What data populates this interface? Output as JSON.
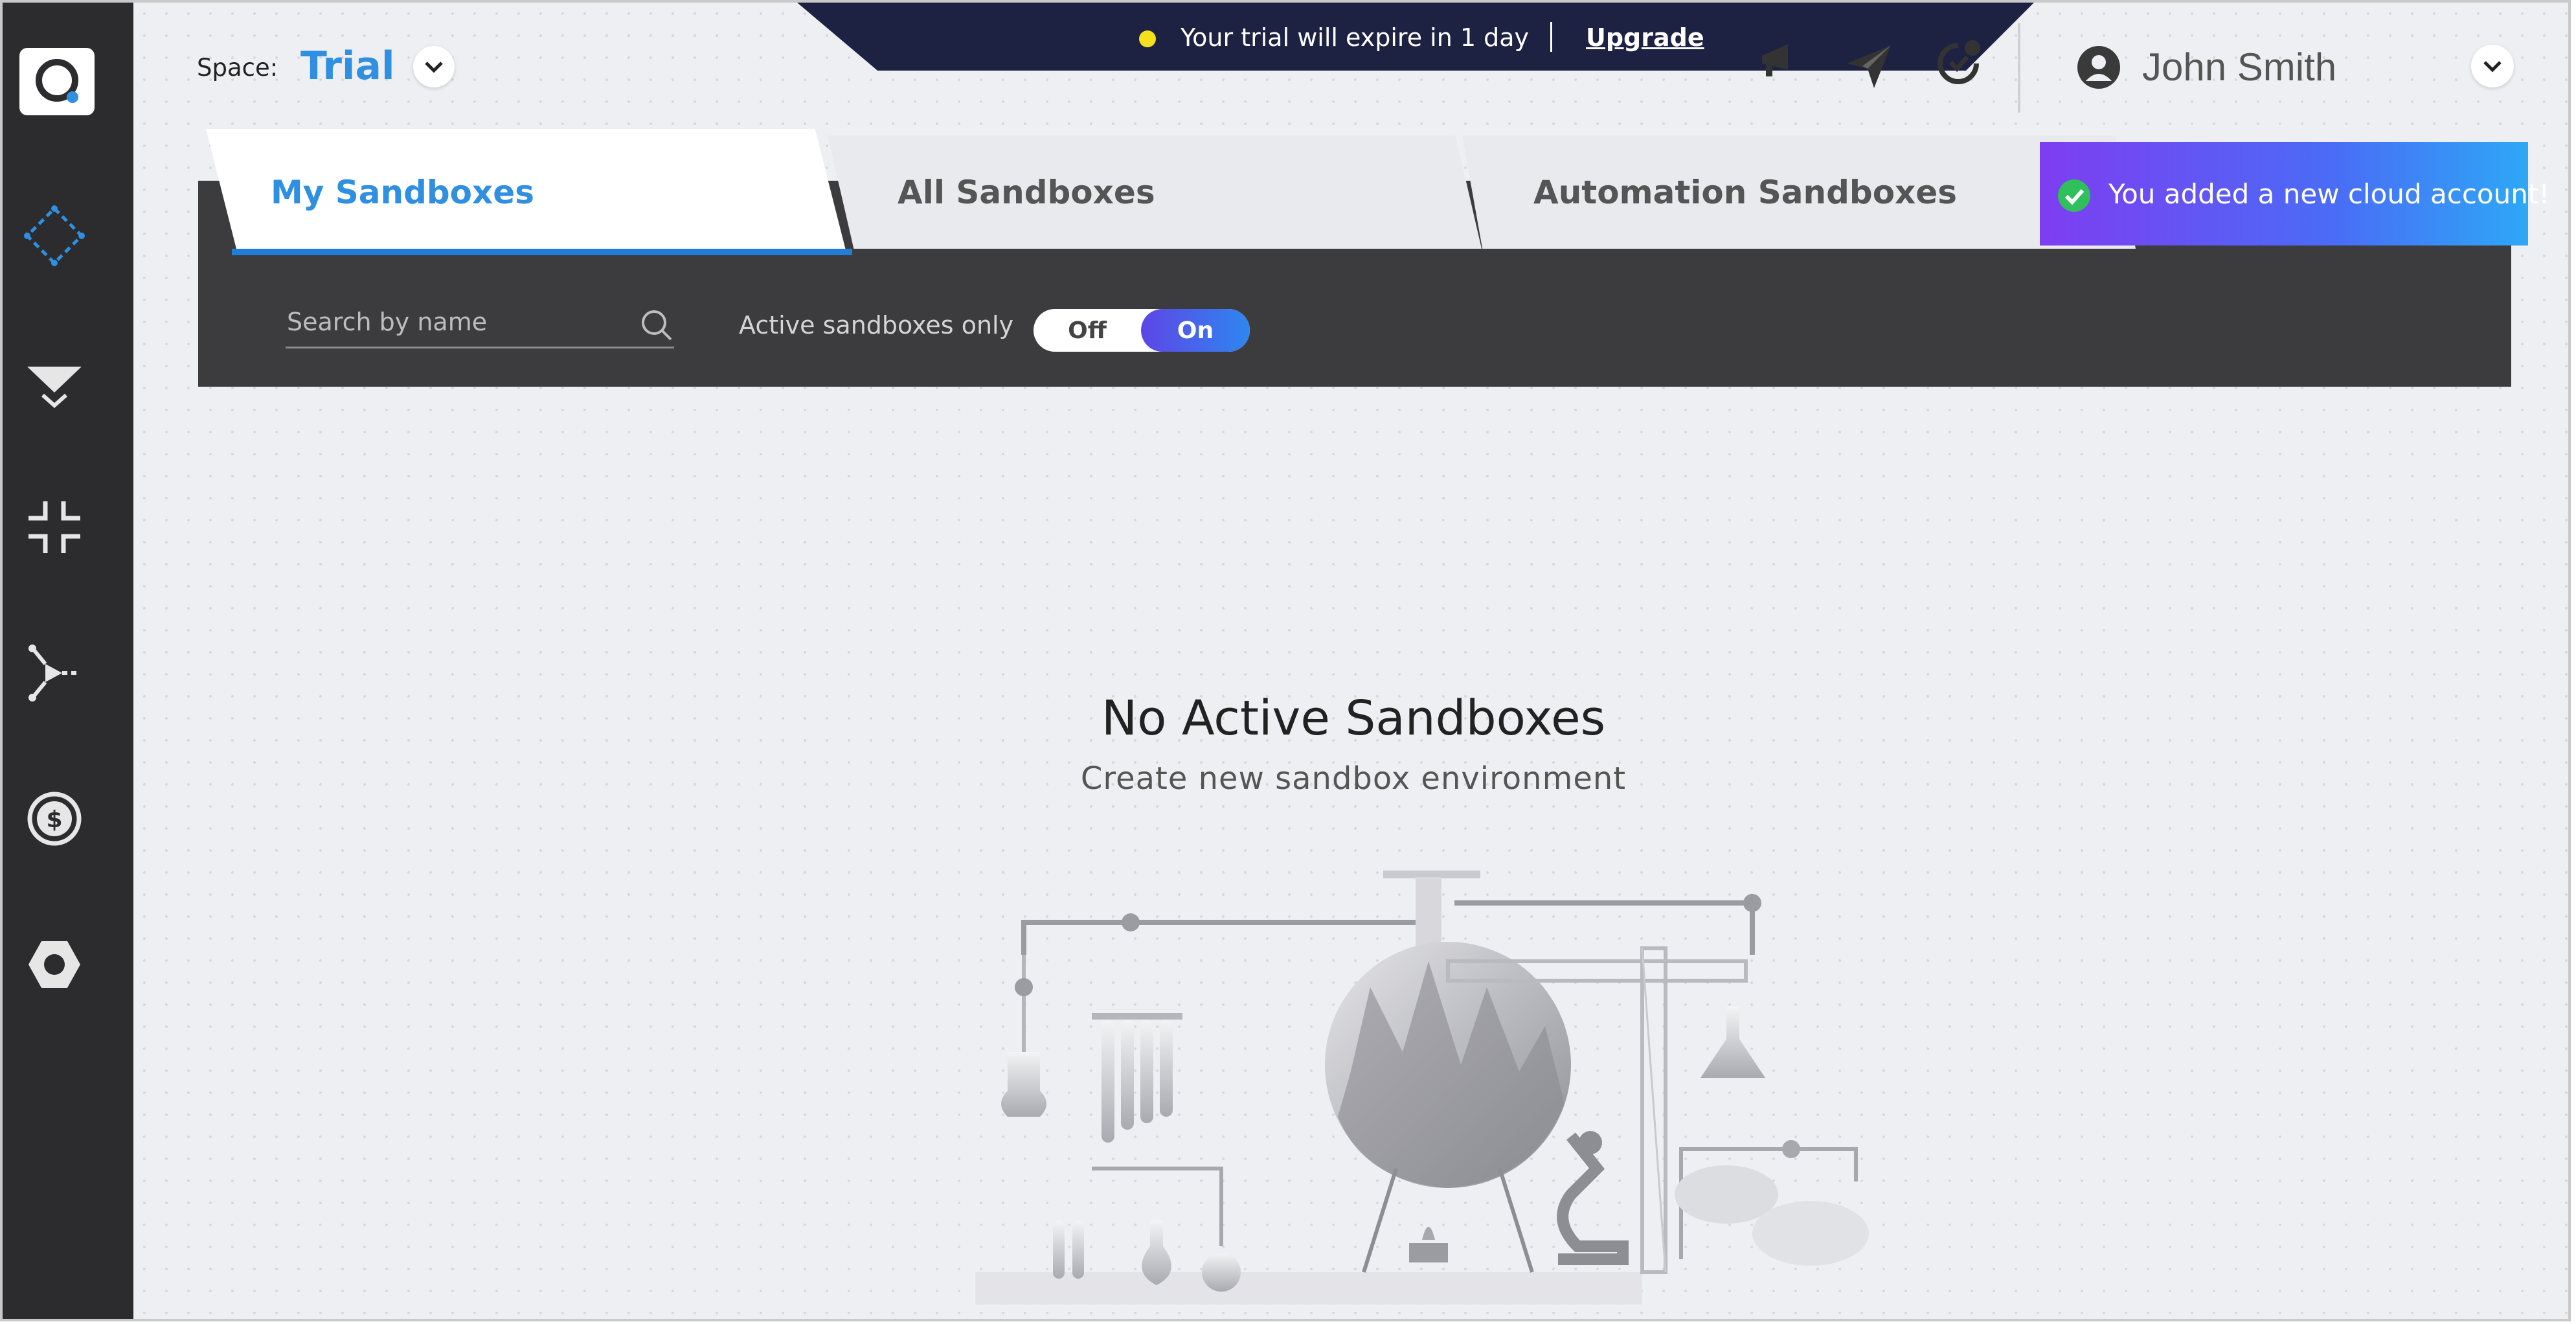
{
  "trial_banner": {
    "message": "Your trial will expire in 1 day",
    "upgrade_label": "Upgrade"
  },
  "space": {
    "label": "Space:",
    "value": "Trial"
  },
  "user": {
    "name": "John Smith"
  },
  "tabs": [
    {
      "label": "My Sandboxes",
      "active": true
    },
    {
      "label": "All Sandboxes",
      "active": false
    },
    {
      "label": "Automation Sandboxes",
      "active": false
    }
  ],
  "filters": {
    "search_placeholder": "Search by name",
    "active_only_label": "Active sandboxes only",
    "toggle_off_label": "Off",
    "toggle_on_label": "On",
    "toggle_state": "On"
  },
  "toast": {
    "message": "You added a new cloud account!"
  },
  "empty_state": {
    "title": "No Active Sandboxes",
    "subtitle": "Create new sandbox environment"
  },
  "sidebar": {
    "icons": [
      "sandbox-icon",
      "filter-icon",
      "compress-icon",
      "blueprint-icon",
      "cost-icon",
      "settings-icon"
    ]
  },
  "colors": {
    "sidebar_bg": "#2c2c2e",
    "accent": "#2f8fe0",
    "banner_bg": "#1d2142",
    "panel_bg": "#3c3c3f"
  }
}
